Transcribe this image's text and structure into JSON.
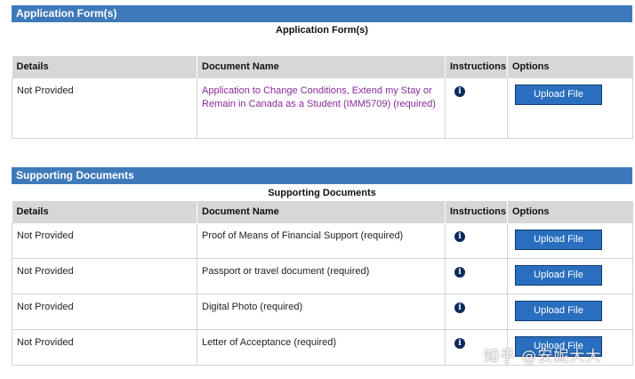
{
  "application_forms": {
    "header": "Application Form(s)",
    "caption": "Application Form(s)",
    "columns": [
      "Details",
      "Document Name",
      "Instructions",
      "Options"
    ],
    "rows": [
      {
        "details": "Not Provided",
        "document_name": "Application to Change Conditions, Extend my Stay or Remain in Canada as a Student (IMM5709)  (required)",
        "option_label": "Upload File"
      }
    ]
  },
  "supporting_documents": {
    "header": "Supporting Documents",
    "caption": "Supporting Documents",
    "columns": [
      "Details",
      "Document Name",
      "Instructions",
      "Options"
    ],
    "rows": [
      {
        "details": "Not Provided",
        "document_name": "Proof of Means of Financial Support  (required)",
        "option_label": "Upload File"
      },
      {
        "details": "Not Provided",
        "document_name": "Passport or travel document  (required)",
        "option_label": "Upload File"
      },
      {
        "details": "Not Provided",
        "document_name": "Digital Photo  (required)",
        "option_label": "Upload File"
      },
      {
        "details": "Not Provided",
        "document_name": "Letter of Acceptance  (required)",
        "option_label": "Upload File"
      }
    ]
  },
  "icons": {
    "instructions": "info-icon"
  },
  "colors": {
    "section_header": "#3e7ab9",
    "table_header": "#d7d7d7",
    "upload_button": "#2a6fbf",
    "link": "#8a2a9c",
    "info_icon": "#0d2a5c"
  },
  "watermark": "知乎 @安妮大大"
}
